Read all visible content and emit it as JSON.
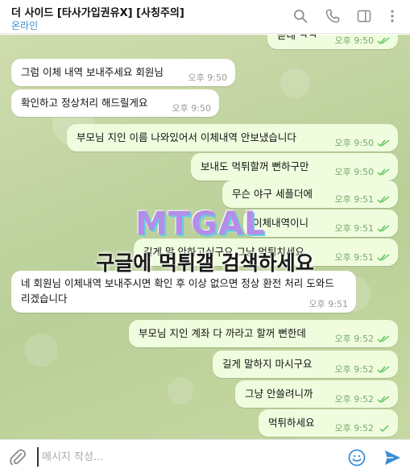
{
  "header": {
    "title": "더 사이드 [타사가입권유X] [사칭주의]",
    "status": "온라인"
  },
  "messages": [
    {
      "dir": "out",
      "text": "곧네 ㅋㅋ",
      "time": "오후 9:50"
    },
    {
      "dir": "in",
      "text": "그럼 이체 내역 보내주세요 회원님",
      "time": "오후 9:50"
    },
    {
      "dir": "in",
      "text": "확인하고 정상처리 해드릴게요",
      "time": "오후 9:50"
    },
    {
      "dir": "out",
      "text": "부모님 지인 이름 나와있어서 이체내역 안보냈습니다",
      "time": "오후 9:50"
    },
    {
      "dir": "out",
      "text": "보내도 먹튀할꺼 뻔하구만",
      "time": "오후 9:50"
    },
    {
      "dir": "out",
      "text": "무슨 야구 세플더에",
      "time": "오후 9:51"
    },
    {
      "dir": "out",
      "text": "이체내역이니",
      "time": "오후 9:51"
    },
    {
      "dir": "out",
      "text": "길게 말 안하고싶구요 그냥 먹튀치세요",
      "time": "오후 9:51"
    },
    {
      "dir": "in",
      "text": "네 회원님 이체내역 보내주시면 확인 후 이상 없으면 정상 환전 처리 도와드리겠습니다",
      "time": "오후 9:51"
    },
    {
      "dir": "out",
      "text": "부모님 지인 계좌 다 까라고 할꺼 뻔한데",
      "time": "오후 9:52"
    },
    {
      "dir": "out",
      "text": "길게 말하지 마시구요",
      "time": "오후 9:52"
    },
    {
      "dir": "out",
      "text": "그냥 안쓸려니까",
      "time": "오후 9:52"
    },
    {
      "dir": "out",
      "text": "먹튀하세요",
      "time": "오후 9:52"
    }
  ],
  "watermark": {
    "logo": "MTGAL",
    "text": "구글에 먹튀갤 검색하세요"
  },
  "composer": {
    "placeholder": "메시지 작성..."
  },
  "icons": {
    "search": "search-icon",
    "call": "phone-icon",
    "sidebar": "sidebar-toggle-icon",
    "more": "more-vertical-icon",
    "attach": "paperclip-icon",
    "emoji": "emoji-icon",
    "send": "send-icon"
  },
  "colors": {
    "accent": "#3a8fd6",
    "outgoing_bubble": "#effdde",
    "incoming_bubble": "#ffffff",
    "check": "#5fbf5f",
    "chat_bg": "#c4d6a4"
  }
}
